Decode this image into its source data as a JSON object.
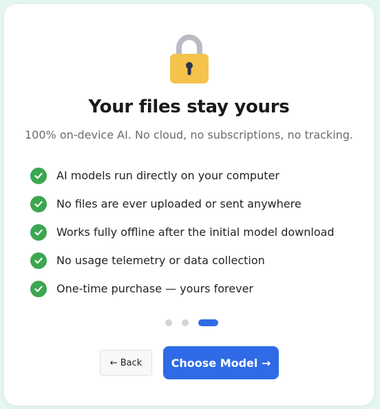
{
  "onboarding": {
    "title": "Your files stay yours",
    "subtitle": "100% on-device AI. No cloud, no subscriptions, no tracking.",
    "lock_icon": "lock-icon",
    "check_icon": "check-icon",
    "features": [
      {
        "text": "AI models run directly on your computer"
      },
      {
        "text": "No files are ever uploaded or sent anywhere"
      },
      {
        "text": "Works fully offline after the initial model download"
      },
      {
        "text": "No usage telemetry or data collection"
      },
      {
        "text": "One-time purchase — yours forever"
      }
    ],
    "pager": {
      "total_steps": 3,
      "current_step": 3
    },
    "back_label": "← Back",
    "next_label": "Choose Model →"
  },
  "colors": {
    "accent": "#2f6be6",
    "check": "#3da651",
    "lock_body": "#f5c24c",
    "background": "#e6f7ef"
  }
}
